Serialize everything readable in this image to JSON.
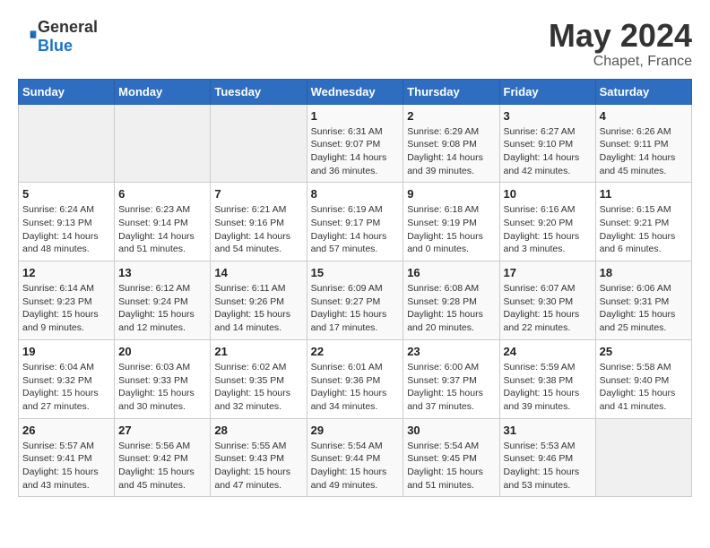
{
  "header": {
    "logo_general": "General",
    "logo_blue": "Blue",
    "month": "May 2024",
    "location": "Chapet, France"
  },
  "calendar": {
    "days_of_week": [
      "Sunday",
      "Monday",
      "Tuesday",
      "Wednesday",
      "Thursday",
      "Friday",
      "Saturday"
    ],
    "weeks": [
      [
        {
          "day": "",
          "info": ""
        },
        {
          "day": "",
          "info": ""
        },
        {
          "day": "",
          "info": ""
        },
        {
          "day": "1",
          "info": "Sunrise: 6:31 AM\nSunset: 9:07 PM\nDaylight: 14 hours\nand 36 minutes."
        },
        {
          "day": "2",
          "info": "Sunrise: 6:29 AM\nSunset: 9:08 PM\nDaylight: 14 hours\nand 39 minutes."
        },
        {
          "day": "3",
          "info": "Sunrise: 6:27 AM\nSunset: 9:10 PM\nDaylight: 14 hours\nand 42 minutes."
        },
        {
          "day": "4",
          "info": "Sunrise: 6:26 AM\nSunset: 9:11 PM\nDaylight: 14 hours\nand 45 minutes."
        }
      ],
      [
        {
          "day": "5",
          "info": "Sunrise: 6:24 AM\nSunset: 9:13 PM\nDaylight: 14 hours\nand 48 minutes."
        },
        {
          "day": "6",
          "info": "Sunrise: 6:23 AM\nSunset: 9:14 PM\nDaylight: 14 hours\nand 51 minutes."
        },
        {
          "day": "7",
          "info": "Sunrise: 6:21 AM\nSunset: 9:16 PM\nDaylight: 14 hours\nand 54 minutes."
        },
        {
          "day": "8",
          "info": "Sunrise: 6:19 AM\nSunset: 9:17 PM\nDaylight: 14 hours\nand 57 minutes."
        },
        {
          "day": "9",
          "info": "Sunrise: 6:18 AM\nSunset: 9:19 PM\nDaylight: 15 hours\nand 0 minutes."
        },
        {
          "day": "10",
          "info": "Sunrise: 6:16 AM\nSunset: 9:20 PM\nDaylight: 15 hours\nand 3 minutes."
        },
        {
          "day": "11",
          "info": "Sunrise: 6:15 AM\nSunset: 9:21 PM\nDaylight: 15 hours\nand 6 minutes."
        }
      ],
      [
        {
          "day": "12",
          "info": "Sunrise: 6:14 AM\nSunset: 9:23 PM\nDaylight: 15 hours\nand 9 minutes."
        },
        {
          "day": "13",
          "info": "Sunrise: 6:12 AM\nSunset: 9:24 PM\nDaylight: 15 hours\nand 12 minutes."
        },
        {
          "day": "14",
          "info": "Sunrise: 6:11 AM\nSunset: 9:26 PM\nDaylight: 15 hours\nand 14 minutes."
        },
        {
          "day": "15",
          "info": "Sunrise: 6:09 AM\nSunset: 9:27 PM\nDaylight: 15 hours\nand 17 minutes."
        },
        {
          "day": "16",
          "info": "Sunrise: 6:08 AM\nSunset: 9:28 PM\nDaylight: 15 hours\nand 20 minutes."
        },
        {
          "day": "17",
          "info": "Sunrise: 6:07 AM\nSunset: 9:30 PM\nDaylight: 15 hours\nand 22 minutes."
        },
        {
          "day": "18",
          "info": "Sunrise: 6:06 AM\nSunset: 9:31 PM\nDaylight: 15 hours\nand 25 minutes."
        }
      ],
      [
        {
          "day": "19",
          "info": "Sunrise: 6:04 AM\nSunset: 9:32 PM\nDaylight: 15 hours\nand 27 minutes."
        },
        {
          "day": "20",
          "info": "Sunrise: 6:03 AM\nSunset: 9:33 PM\nDaylight: 15 hours\nand 30 minutes."
        },
        {
          "day": "21",
          "info": "Sunrise: 6:02 AM\nSunset: 9:35 PM\nDaylight: 15 hours\nand 32 minutes."
        },
        {
          "day": "22",
          "info": "Sunrise: 6:01 AM\nSunset: 9:36 PM\nDaylight: 15 hours\nand 34 minutes."
        },
        {
          "day": "23",
          "info": "Sunrise: 6:00 AM\nSunset: 9:37 PM\nDaylight: 15 hours\nand 37 minutes."
        },
        {
          "day": "24",
          "info": "Sunrise: 5:59 AM\nSunset: 9:38 PM\nDaylight: 15 hours\nand 39 minutes."
        },
        {
          "day": "25",
          "info": "Sunrise: 5:58 AM\nSunset: 9:40 PM\nDaylight: 15 hours\nand 41 minutes."
        }
      ],
      [
        {
          "day": "26",
          "info": "Sunrise: 5:57 AM\nSunset: 9:41 PM\nDaylight: 15 hours\nand 43 minutes."
        },
        {
          "day": "27",
          "info": "Sunrise: 5:56 AM\nSunset: 9:42 PM\nDaylight: 15 hours\nand 45 minutes."
        },
        {
          "day": "28",
          "info": "Sunrise: 5:55 AM\nSunset: 9:43 PM\nDaylight: 15 hours\nand 47 minutes."
        },
        {
          "day": "29",
          "info": "Sunrise: 5:54 AM\nSunset: 9:44 PM\nDaylight: 15 hours\nand 49 minutes."
        },
        {
          "day": "30",
          "info": "Sunrise: 5:54 AM\nSunset: 9:45 PM\nDaylight: 15 hours\nand 51 minutes."
        },
        {
          "day": "31",
          "info": "Sunrise: 5:53 AM\nSunset: 9:46 PM\nDaylight: 15 hours\nand 53 minutes."
        },
        {
          "day": "",
          "info": ""
        }
      ]
    ]
  }
}
